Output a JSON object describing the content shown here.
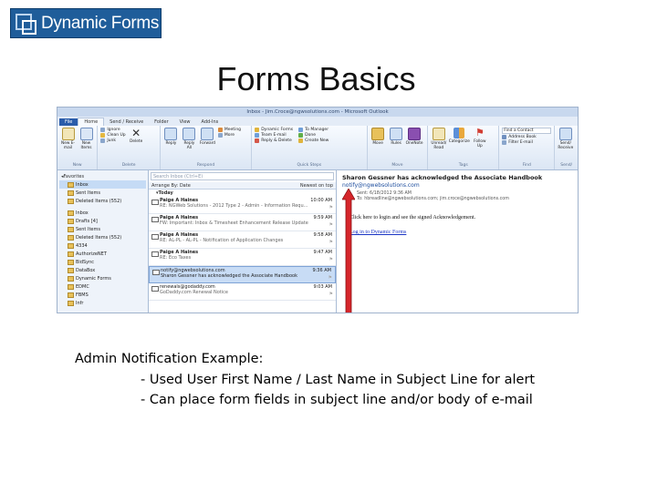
{
  "logo": {
    "text": "Dynamic Forms"
  },
  "slide": {
    "title": "Forms Basics",
    "caption": {
      "line1": "Admin Notification Example:",
      "line2": "- Used User First Name / Last Name in Subject Line for alert",
      "line3": "- Can place form fields in subject line and/or body of e-mail"
    }
  },
  "outlook": {
    "window_title": "Inbox - Jim.Croce@ngwsolutions.com - Microsoft Outlook",
    "tabs": [
      "File",
      "Home",
      "Send / Receive",
      "Folder",
      "View",
      "Add-Ins"
    ],
    "ribbon": {
      "new": {
        "label": "New",
        "new_email": "New E-mail",
        "new_items": "New Items"
      },
      "delete": {
        "label": "Delete",
        "ignore": "Ignore",
        "clean_up": "Clean Up",
        "junk": "Junk",
        "delete_btn": "Delete"
      },
      "respond": {
        "label": "Respond",
        "reply": "Reply",
        "reply_all": "Reply All",
        "forward": "Forward",
        "meeting": "Meeting",
        "more": "More"
      },
      "quick_steps": {
        "label": "Quick Steps",
        "items": [
          "Dynamic Forms",
          "Team E-mail",
          "Reply & Delete",
          "To Manager",
          "Done",
          "Create New"
        ]
      },
      "move": {
        "label": "Move",
        "move_btn": "Move",
        "rules": "Rules",
        "onenote": "OneNote"
      },
      "tags": {
        "label": "Tags",
        "unread": "Unread/ Read",
        "categorize": "Categorize",
        "follow_up": "Follow Up"
      },
      "find": {
        "label": "Find",
        "find_contact": "Find a Contact",
        "address_book": "Address Book",
        "filter": "Filter E-mail"
      },
      "send": {
        "label": "Send/",
        "send_receive": "Send/ Receive"
      }
    },
    "nav": {
      "favorites_header": "Favorites",
      "favorites": [
        "Inbox",
        "Sent Items",
        "Deleted Items (552)"
      ],
      "folders": [
        "Inbox",
        "Drafts [4]",
        "Sent Items",
        "Deleted Items (552)",
        "4334",
        "AuthorizeNET",
        "BidSync",
        "DataBox",
        "Dynamic Forms",
        "EDMC",
        "FBMS",
        "Infr"
      ]
    },
    "list": {
      "search_placeholder": "Search Inbox (Ctrl+E)",
      "arrange": "Arrange By: Date",
      "order": "Newest on top",
      "group": "Today",
      "messages": [
        {
          "from": "Paige A Haines",
          "time": "10:00 AM",
          "subject": "RE: NGWeb Solutions - 2012 Type 2 - Admin - Information Requ..."
        },
        {
          "from": "Paige A Haines",
          "time": "9:59 AM",
          "subject": "FW: Important: Inbox & Timesheet Enhancement Release Update"
        },
        {
          "from": "Paige A Haines",
          "time": "9:58 AM",
          "subject": "RE: AL-PL - AL-PL - Notification of Application Changes"
        },
        {
          "from": "Paige A Haines",
          "time": "9:47 AM",
          "subject": "RE: Eco Taxes"
        },
        {
          "from": "notify@ngwebsolutions.com",
          "time": "9:36 AM",
          "subject": "Sharon Gessner has acknowledged the Associate Handbook"
        },
        {
          "from": "renewals@godaddy.com",
          "time": "9:03 AM",
          "subject": "GoDaddy.com Renewal Notice"
        }
      ]
    },
    "reading": {
      "subject": "Sharon Gessner has acknowledged the Associate Handbook",
      "from": "notify@ngwebsolutions.com",
      "sent": "Sent: 6/18/2012 9:36 AM",
      "to": "To: hbreadline@ngwebsolutions.com; jim.croce@ngwebsolutions.com",
      "body": "Click here to login and see the signed Acknowledgement.",
      "link": "Log in to Dynamic Forms"
    }
  },
  "colors": {
    "logo_bg": "#1f5d9a",
    "arrow": "#d6262b",
    "link": "#1a35c4"
  }
}
